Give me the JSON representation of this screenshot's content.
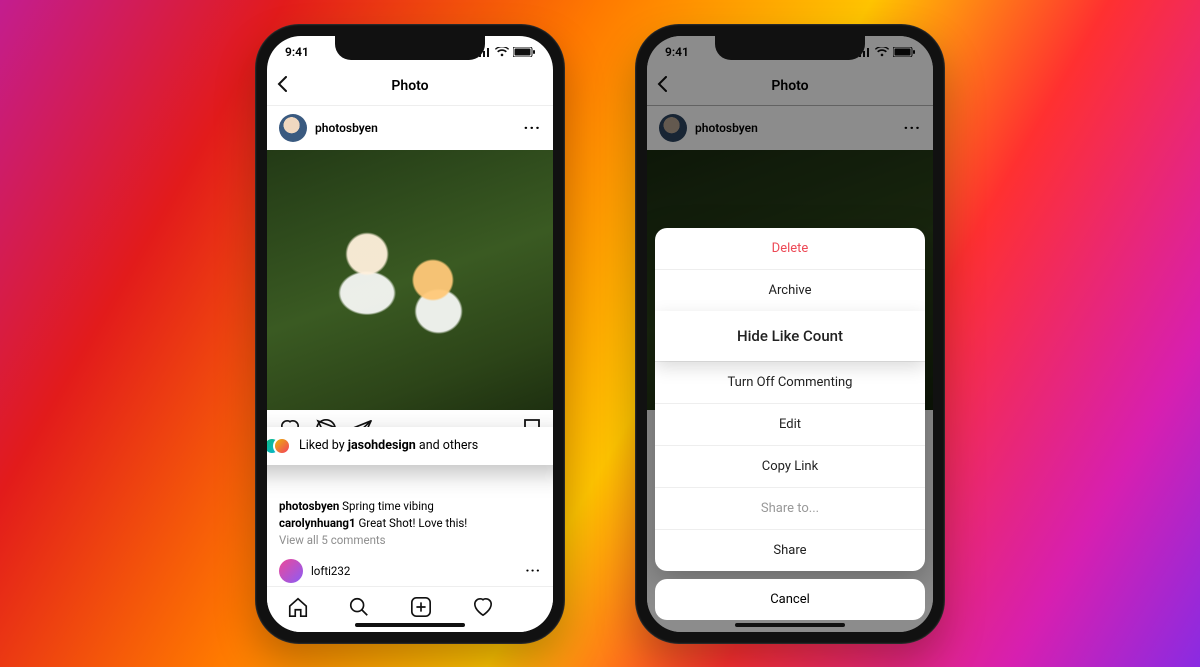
{
  "status": {
    "time": "9:41"
  },
  "header": {
    "title": "Photo"
  },
  "post": {
    "username": "photosbyen",
    "likes_prefix": "Liked by ",
    "likes_user": "jasohdesign",
    "likes_suffix": " and others",
    "caption_user": "photosbyen",
    "caption_text": " Spring time vibing",
    "comment_user": "carolynhuang1",
    "comment_text": " Great Shot! Love this!",
    "view_all": "View all 5 comments",
    "composer_user": "lofti232"
  },
  "sheet": {
    "items": [
      {
        "label": "Delete",
        "kind": "danger"
      },
      {
        "label": "Archive",
        "kind": "normal"
      },
      {
        "label": "Hide Like Count",
        "kind": "highlight"
      },
      {
        "label": "Turn Off Commenting",
        "kind": "normal"
      },
      {
        "label": "Edit",
        "kind": "normal"
      },
      {
        "label": "Copy Link",
        "kind": "normal"
      },
      {
        "label": "Share to...",
        "kind": "muted"
      },
      {
        "label": "Share",
        "kind": "normal"
      }
    ],
    "cancel": "Cancel"
  }
}
